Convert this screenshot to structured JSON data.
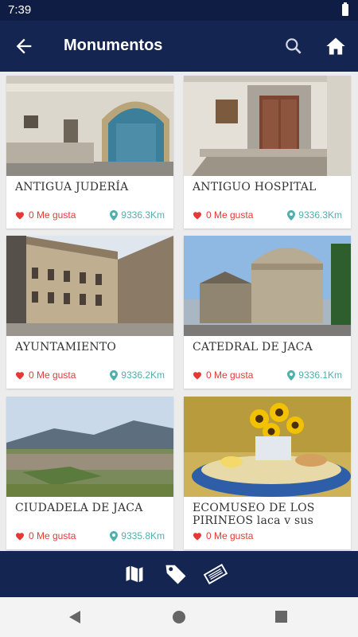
{
  "status": {
    "time": "7:39"
  },
  "appbar": {
    "title": "Monumentos"
  },
  "cards": [
    {
      "name": "ANTIGUA JUDERÍA",
      "likes": "0 Me gusta",
      "distance": "9336.3Km"
    },
    {
      "name": "ANTIGUO HOSPITAL",
      "likes": "0 Me gusta",
      "distance": "9336.3Km"
    },
    {
      "name": "AYUNTAMIENTO",
      "likes": "0 Me gusta",
      "distance": "9336.2Km"
    },
    {
      "name": "CATEDRAL DE JACA",
      "likes": "0 Me gusta",
      "distance": "9336.1Km"
    },
    {
      "name": "CIUDADELA DE JACA",
      "likes": "0 Me gusta",
      "distance": "9335.8Km"
    },
    {
      "name": "ECOMUSEO DE LOS PIRINEOS laca v sus",
      "likes": "0 Me gusta",
      "distance": ""
    }
  ],
  "icons": {
    "back": "arrow-back-icon",
    "search": "search-icon",
    "home": "home-icon",
    "map": "map-icon",
    "tag": "tag-icon",
    "ticket": "ticket-icon",
    "like": "heart-icon",
    "location": "map-pin-icon"
  },
  "colors": {
    "appbar": "#142551",
    "statusbar": "#0f1d44",
    "like": "#e53935",
    "distance": "#4fb0ad"
  }
}
